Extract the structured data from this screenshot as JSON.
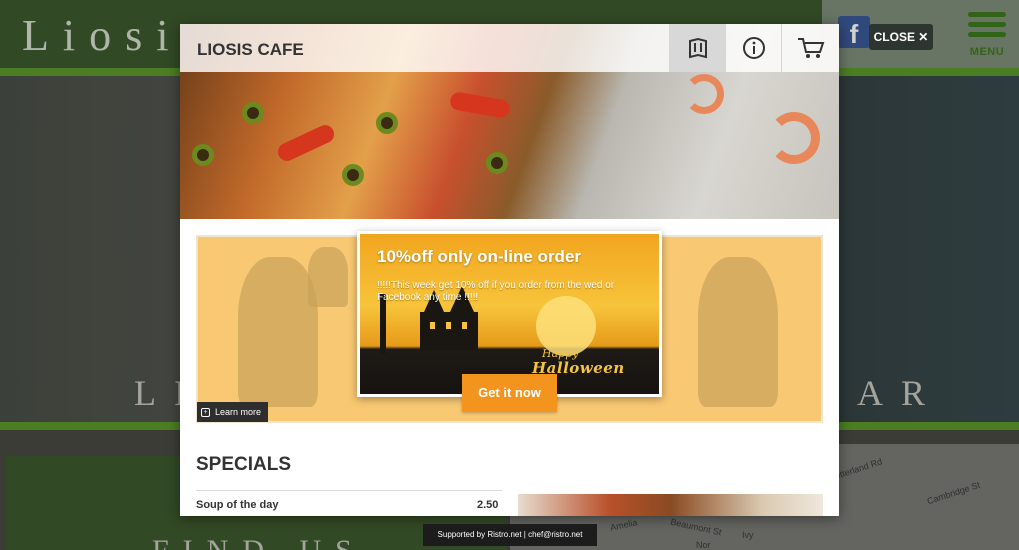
{
  "background_site": {
    "logo_text": "Liosi",
    "menu_label": "MENU",
    "hero_left_text": "LI",
    "hero_right_text": "AR",
    "find_text": "FIND US",
    "map_labels": [
      "Otterland Rd",
      "Cambridge St",
      "Amelia",
      "Beaumont St",
      "Ivy",
      "Nor"
    ]
  },
  "close_button": {
    "label": "CLOSE ✕"
  },
  "modal": {
    "title": "LIOSIS CAFE",
    "toolbar_icons": [
      "menu-book-icon",
      "info-icon",
      "cart-icon"
    ]
  },
  "promo": {
    "heading": "10%off only on-line order",
    "description": "!!!!!This week get 10% off if you order from the wed or Facebook any time !!!!!",
    "image_text_happy": "Happy",
    "image_text_halloween": "Halloween",
    "cta_label": "Get it now",
    "learn_more_label": "Learn more"
  },
  "specials": {
    "title": "SPECIALS",
    "items": [
      {
        "name": "Soup of the day",
        "price": "2.50"
      }
    ]
  },
  "footer": {
    "text": "Supported by Ristro.net | chef@ristro.net"
  },
  "colors": {
    "site_green": "#3e5a2e",
    "accent_green": "#5c9a2a",
    "cta_orange": "#f2941d",
    "promo_orange": "#f8c873"
  }
}
